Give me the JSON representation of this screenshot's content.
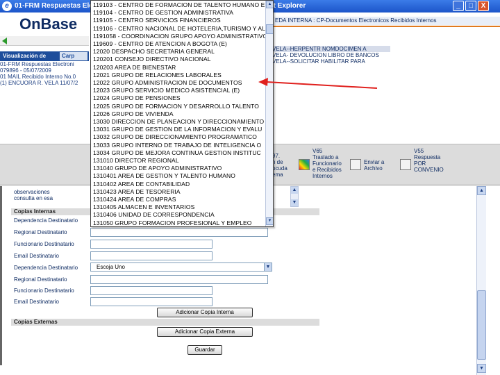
{
  "window": {
    "title_left": "01-FRM Respuestas Electro",
    "title_right": "et Explorer",
    "min": "_",
    "max": "□",
    "close": "X"
  },
  "header": {
    "logo": "OnBase",
    "topnav": "EDA INTERNA : CP-Documentos Electronicos Recibidos Internos"
  },
  "left_panel": {
    "tab_label": "Visualización de",
    "tab2_label": "Carp",
    "info_lines": [
      "01-FRM Respuestas Electroni",
      "079896 - 05/07/2009",
      "01 MAIL Recibido Interno No.0",
      "(1) ENCUORA R. VELA 11/07/2"
    ]
  },
  "right_docs": {
    "lines": [
      "VELA--HERPENTR NOMDOCIMEN A",
      "VELA- DEVOLUCION LIBRO DE BANCOS",
      "VELA--SOLICITAR HABILITAR PARA"
    ]
  },
  "tools": [
    {
      "text": "97.\nn de\nocuda\nema",
      "icon": "document-icon"
    },
    {
      "text": "V65\nTraslado a\nFuncionario\ne Recibidos\nInternos",
      "icon": "color-swatch-icon"
    },
    {
      "text": "Enviar a\nArchivo",
      "icon": "archive-icon"
    },
    {
      "text": "V55\nRespuesta\nPOR\nCONVENIO",
      "icon": "reply-icon"
    }
  ],
  "dropdown": {
    "items": [
      "119103 - CENTRO DE FORMACION DE TALENTO HUMANO E",
      "119104 - CENTRO DE GESTION ADMINISTRATIVA",
      "119105 - CENTRO SERVICIOS FINANCIEROS",
      "119106 - CENTRO NACIONAL DE HOTELERIA,TURISMO Y AL",
      "1191058 - COORDINACION GRUPO APOYO ADMINISTRATIVO",
      "119609 - CENTRO DE ATENCION A BOGOTA (E)",
      "12020  DESPACHO SECRETARIA GENERAL",
      "120201  CONSEJO DIRECTIVO NACIONAL",
      "120203  AREA DE BIENESTAR",
      "12021  GRUPO DE RELACIONES LABORALES",
      "12022  GRUPO ADMINISTRACION DE DOCUMENTOS",
      "12023  GRUPO SERVICIO MEDICO ASISTENCIAL (E)",
      "12024  GRUPO DE PENSIONES",
      "12025  GRUPO DE FORMACION Y DESARROLLO TALENTO",
      "12026  GRUPO DE VIVIENDA",
      "13030  DIRECCION DE PLANEACION Y DIRECCIONAMIENTO",
      "13031  GRUPO DE GESTION DE LA INFORMACION Y EVALU",
      "13032  GRUPO DE DIRECCIONAMIENTO PROGRAMATICO",
      "13033  GRUPO INTERNO DE TRABAJO DE INTELIGENCIA O",
      "13034  GRUPO DE MEJORA CONTINUA GESTION INSTITUC",
      "131010  DIRECTOR REGIONAL",
      "131040  GRUPO DE APOYO ADMINISTRATIVO",
      "1310401  AREA DE GESTION Y TALENTO HUMANO",
      "1310402  AREA DE CONTABILIDAD",
      "1310423  AREA DE TESORERIA",
      "1310424  AREA DE COMPRAS",
      "1310405  ALMACEN E INVENTARIOS",
      "1310406  UNIDAD DE CORRESPONDENCIA",
      "131050  GRUPO FORMACION PROFESIONAL Y EMPLEO"
    ],
    "scroll_up": "▲",
    "scroll_down": "▼"
  },
  "form": {
    "consulta_lines": [
      "observaciones",
      "consulta en esa"
    ],
    "section_internas": "Copias Internas",
    "section_externas": "Copias Externas",
    "labels": {
      "dep1": "Dependencia Destinatario",
      "reg1": "Regional Destinatario",
      "fun1": "Funcionario Destinatario",
      "mail1": "Email Destinatario",
      "dep2": "Dependencia Destinatario",
      "reg2": "Regional Destinatario",
      "fun2": "Funcionario Destinatario",
      "mail2": "Email Destinatario"
    },
    "select_value": "Escoja Uno",
    "btn_add_internal": "Adicionar Copia Interna",
    "btn_add_external": "Adicionar Copia Externa",
    "btn_save": "Guardar"
  },
  "colors": {
    "title_bar": "#1c55c9",
    "accent_orange": "#e07a1f",
    "annotation_arrow": "#e0201d",
    "navy_text": "#0f2c63"
  }
}
